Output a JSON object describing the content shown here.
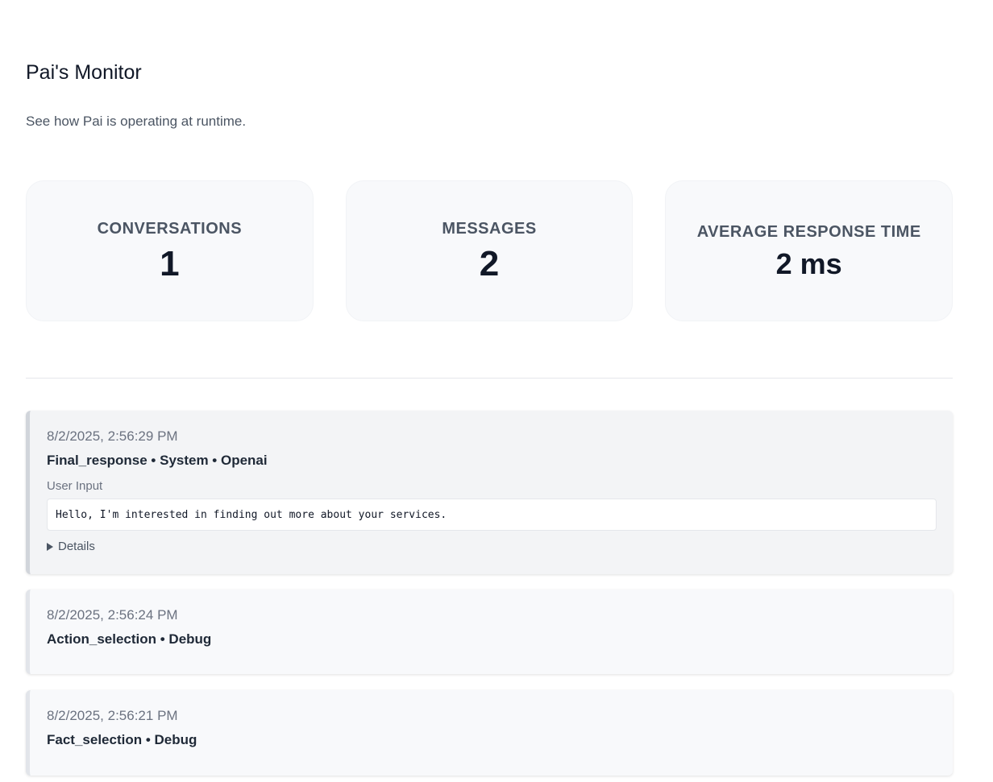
{
  "header": {
    "title": "Pai's Monitor",
    "subtitle": "See how Pai is operating at runtime."
  },
  "stats": [
    {
      "label": "CONVERSATIONS",
      "value": "1"
    },
    {
      "label": "MESSAGES",
      "value": "2"
    },
    {
      "label": "AVERAGE RESPONSE TIME",
      "value": "2 ms"
    }
  ],
  "logs": [
    {
      "time": "8/2/2025, 2:56:29 PM",
      "title": "Final_response • System • Openai",
      "input_label": "User Input",
      "input_value": "Hello, I'm interested in finding out more about your services.",
      "details_label": "Details"
    },
    {
      "time": "8/2/2025, 2:56:24 PM",
      "title": "Action_selection • Debug"
    },
    {
      "time": "8/2/2025, 2:56:21 PM",
      "title": "Fact_selection • Debug"
    }
  ]
}
